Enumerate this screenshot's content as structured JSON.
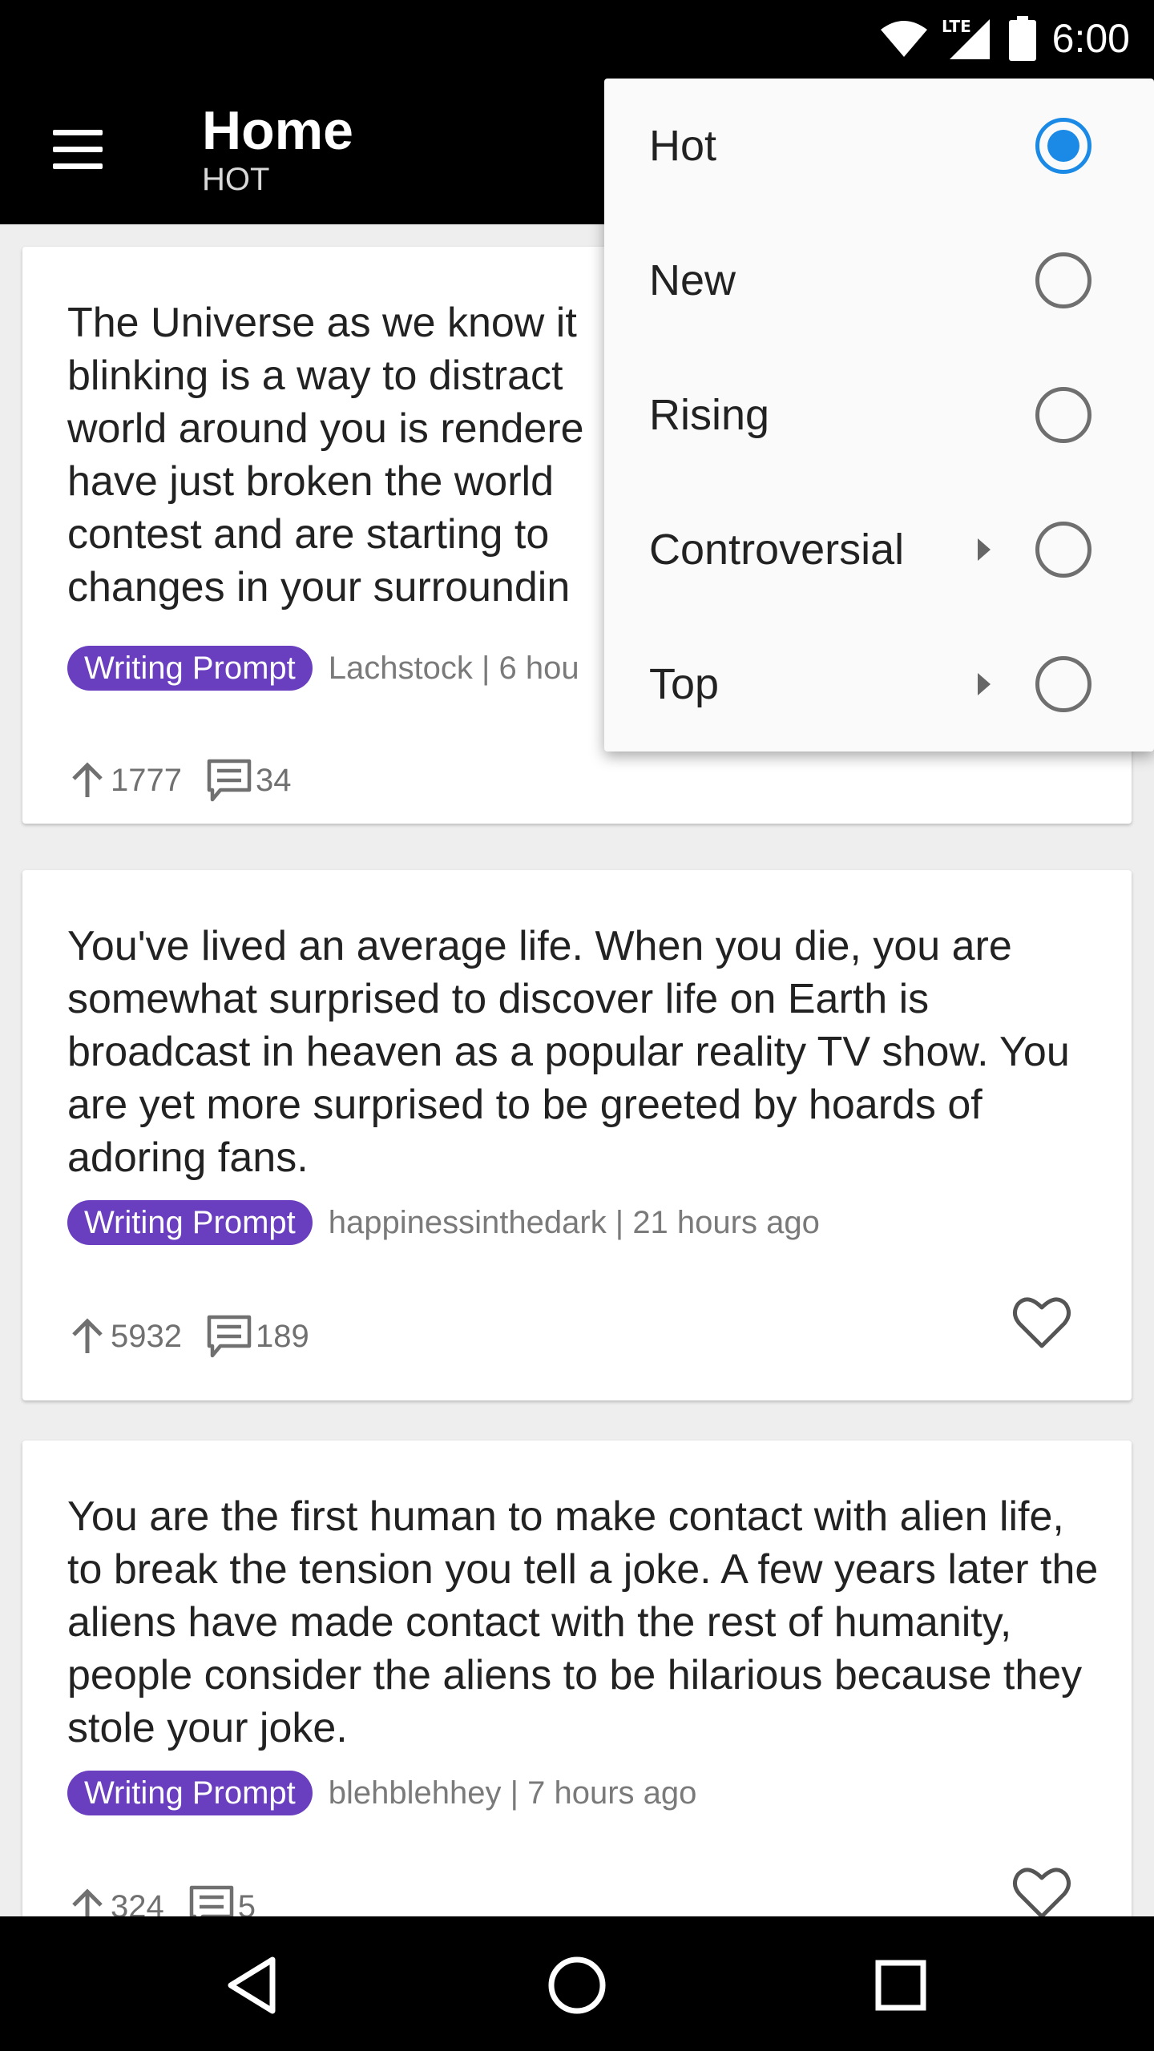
{
  "status_bar": {
    "time": "6:00",
    "network": "LTE"
  },
  "app_bar": {
    "title": "Home",
    "subtitle": "HOT"
  },
  "posts": [
    {
      "title": "The Universe as we know it\nblinking is a way to distract\nworld around you is rendere\nhave just broken the world\ncontest and are starting to\nchanges in your surroundin",
      "flair": "Writing Prompt",
      "meta": "Lachstock | 6 hou",
      "upvotes": "1777",
      "comments": "34"
    },
    {
      "title": "You've lived an average life. When you die, you are somewhat surprised to discover life on Earth is broadcast in heaven as a popular reality TV show. You are yet more surprised to be greeted by hoards of adoring fans.",
      "flair": "Writing Prompt",
      "meta": "happinessinthedark | 21 hours ago",
      "upvotes": "5932",
      "comments": "189"
    },
    {
      "title": "You are the first human to make contact with alien life, to break the tension you tell a joke. A few years later the aliens have made contact with the rest of humanity, people consider the aliens to be hilarious because they stole your joke.",
      "flair": "Writing Prompt",
      "meta": "blehblehhey | 7 hours ago",
      "upvotes": "324",
      "comments": "5"
    }
  ],
  "sort_menu": {
    "items": [
      {
        "label": "Hot",
        "selected": true,
        "has_submenu": false
      },
      {
        "label": "New",
        "selected": false,
        "has_submenu": false
      },
      {
        "label": "Rising",
        "selected": false,
        "has_submenu": false
      },
      {
        "label": "Controversial",
        "selected": false,
        "has_submenu": true
      },
      {
        "label": "Top",
        "selected": false,
        "has_submenu": true
      }
    ]
  },
  "colors": {
    "flair": "#6a3fbf",
    "radio_selected": "#1a8ae6",
    "app_bar": "#000000"
  },
  "icons": [
    "menu-icon",
    "upvote-icon",
    "comment-icon",
    "heart-icon",
    "back-icon",
    "home-icon",
    "recents-icon",
    "wifi-icon",
    "signal-icon",
    "battery-icon"
  ]
}
